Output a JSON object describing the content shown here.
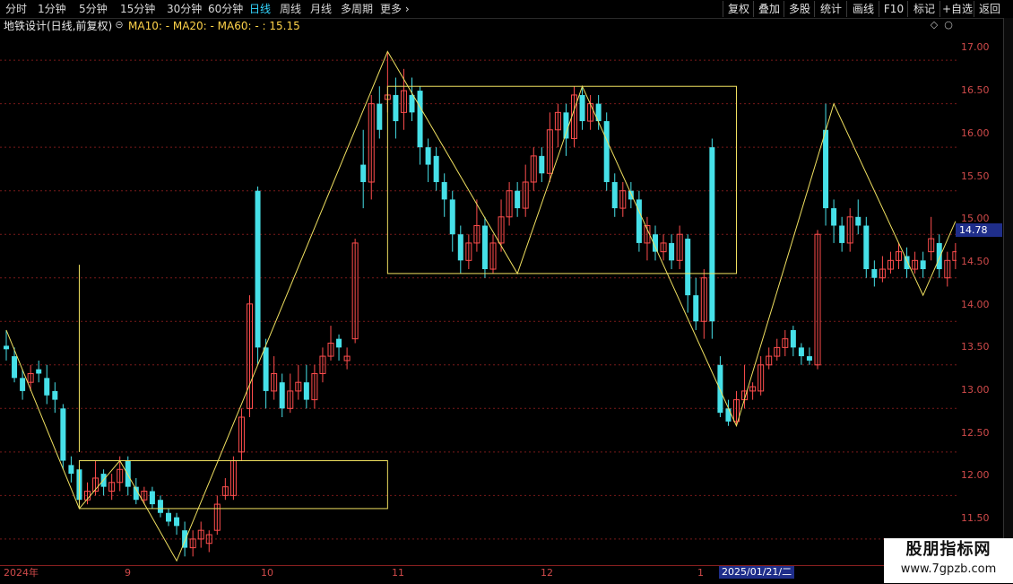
{
  "toolbar": {
    "periods": [
      "分时",
      "1分钟",
      "5分钟",
      "15分钟",
      "30分钟",
      "60分钟",
      "日线",
      "周线",
      "月线",
      "多周期",
      "更多"
    ],
    "active_period": "日线",
    "more_arrow": "chevron-right-icon",
    "right_buttons": [
      "复权",
      "叠加",
      "多股",
      "统计",
      "画线",
      "F10",
      "标记",
      "+自选",
      "返回"
    ]
  },
  "info": {
    "title": "地铁设计(日线,前复权)",
    "ma_text": "MA10: -  MA20: -  MA60: - : 15.15"
  },
  "price_axis": {
    "ticks": [
      "17.00",
      "16.50",
      "16.00",
      "15.50",
      "15.00",
      "14.50",
      "14.00",
      "13.50",
      "13.00",
      "12.50",
      "12.00",
      "11.50"
    ],
    "last_price": "14.78"
  },
  "date_axis": {
    "ticks": [
      "2024年",
      "9",
      "10",
      "11",
      "12",
      "1"
    ],
    "cursor_date": "2025/01/21/二"
  },
  "watermark": {
    "title": "股朋指标网",
    "url": "www.7gpzb.com"
  },
  "colors": {
    "up": "#ff4d4d",
    "down": "#46e0e8",
    "line": "#f0e060",
    "grid": "#7a1a1a",
    "axis": "#d04a4a"
  },
  "chart_data": {
    "type": "candlestick",
    "ylim": [
      11.2,
      17.3
    ],
    "candles": [
      [
        13.72,
        13.68,
        13.9,
        13.55
      ],
      [
        13.6,
        13.35,
        13.7,
        13.3
      ],
      [
        13.35,
        13.2,
        13.45,
        13.1
      ],
      [
        13.3,
        13.4,
        13.5,
        13.2
      ],
      [
        13.45,
        13.4,
        13.55,
        13.3
      ],
      [
        13.35,
        13.15,
        13.5,
        13.05
      ],
      [
        13.2,
        13.1,
        13.3,
        12.95
      ],
      [
        13.0,
        12.4,
        13.05,
        12.3
      ],
      [
        12.35,
        12.25,
        12.45,
        12.15
      ],
      [
        12.3,
        11.95,
        12.35,
        11.9
      ],
      [
        11.95,
        12.05,
        12.15,
        11.9
      ],
      [
        12.05,
        12.2,
        12.4,
        12.0
      ],
      [
        12.25,
        12.1,
        12.3,
        12.0
      ],
      [
        12.05,
        12.15,
        12.25,
        11.95
      ],
      [
        12.15,
        12.3,
        12.45,
        12.05
      ],
      [
        12.4,
        12.1,
        12.45,
        12.0
      ],
      [
        12.1,
        11.95,
        12.2,
        11.9
      ],
      [
        11.95,
        12.05,
        12.1,
        11.9
      ],
      [
        12.05,
        11.9,
        12.1,
        11.85
      ],
      [
        11.95,
        11.8,
        12.0,
        11.75
      ],
      [
        11.8,
        11.7,
        11.85,
        11.65
      ],
      [
        11.75,
        11.65,
        11.8,
        11.55
      ],
      [
        11.6,
        11.4,
        11.7,
        11.3
      ],
      [
        11.4,
        11.5,
        11.6,
        11.3
      ],
      [
        11.5,
        11.6,
        11.7,
        11.4
      ],
      [
        11.45,
        11.55,
        11.6,
        11.35
      ],
      [
        11.6,
        11.9,
        12.0,
        11.55
      ],
      [
        12.0,
        12.1,
        12.2,
        11.95
      ],
      [
        12.0,
        12.4,
        12.45,
        11.95
      ],
      [
        12.5,
        12.9,
        13.0,
        12.4
      ],
      [
        13.0,
        14.2,
        14.3,
        12.9
      ],
      [
        15.5,
        13.7,
        15.55,
        13.5
      ],
      [
        13.7,
        13.2,
        13.8,
        13.0
      ],
      [
        13.2,
        13.4,
        13.6,
        13.1
      ],
      [
        13.3,
        13.0,
        13.4,
        12.9
      ],
      [
        13.0,
        13.2,
        13.4,
        12.95
      ],
      [
        13.2,
        13.3,
        13.5,
        13.1
      ],
      [
        13.3,
        13.1,
        13.5,
        13.0
      ],
      [
        13.1,
        13.4,
        13.5,
        13.0
      ],
      [
        13.4,
        13.6,
        13.7,
        13.3
      ],
      [
        13.6,
        13.75,
        13.95,
        13.55
      ],
      [
        13.8,
        13.7,
        13.85,
        13.55
      ],
      [
        13.55,
        13.6,
        13.7,
        13.45
      ],
      [
        13.8,
        14.9,
        14.95,
        13.75
      ],
      [
        15.8,
        15.6,
        16.2,
        15.3
      ],
      [
        15.6,
        16.5,
        16.6,
        15.4
      ],
      [
        16.5,
        16.2,
        16.7,
        16.1
      ],
      [
        16.55,
        16.6,
        17.1,
        16.4
      ],
      [
        16.6,
        16.3,
        16.8,
        16.1
      ],
      [
        16.4,
        16.65,
        16.9,
        16.2
      ],
      [
        16.6,
        16.4,
        16.8,
        16.3
      ],
      [
        16.65,
        16.0,
        16.7,
        15.8
      ],
      [
        16.0,
        15.8,
        16.1,
        15.6
      ],
      [
        15.9,
        15.6,
        16.0,
        15.5
      ],
      [
        15.6,
        15.4,
        15.7,
        15.2
      ],
      [
        15.4,
        15.0,
        15.5,
        14.8
      ],
      [
        15.0,
        14.7,
        15.1,
        14.55
      ],
      [
        14.7,
        14.9,
        15.0,
        14.6
      ],
      [
        14.9,
        15.1,
        15.4,
        14.8
      ],
      [
        15.1,
        14.6,
        15.2,
        14.5
      ],
      [
        14.6,
        14.9,
        15.0,
        14.55
      ],
      [
        14.9,
        15.2,
        15.4,
        14.8
      ],
      [
        15.2,
        15.5,
        15.6,
        15.1
      ],
      [
        15.5,
        15.3,
        15.6,
        15.2
      ],
      [
        15.3,
        15.6,
        15.8,
        15.2
      ],
      [
        15.6,
        15.9,
        16.0,
        15.5
      ],
      [
        15.9,
        15.7,
        16.0,
        15.6
      ],
      [
        15.7,
        16.2,
        16.4,
        15.6
      ],
      [
        16.2,
        16.4,
        16.5,
        16.0
      ],
      [
        16.4,
        16.1,
        16.5,
        15.9
      ],
      [
        16.1,
        16.6,
        16.7,
        16.0
      ],
      [
        16.6,
        16.3,
        16.7,
        16.2
      ],
      [
        16.3,
        16.5,
        16.6,
        16.2
      ],
      [
        16.5,
        16.3,
        16.6,
        16.2
      ],
      [
        16.3,
        15.6,
        16.4,
        15.5
      ],
      [
        15.6,
        15.3,
        15.7,
        15.2
      ],
      [
        15.3,
        15.5,
        15.6,
        15.2
      ],
      [
        15.5,
        15.4,
        15.6,
        15.3
      ],
      [
        15.4,
        14.9,
        15.5,
        14.8
      ],
      [
        14.9,
        15.1,
        15.2,
        14.7
      ],
      [
        15.0,
        14.8,
        15.1,
        14.7
      ],
      [
        14.8,
        14.9,
        15.0,
        14.7
      ],
      [
        14.9,
        14.7,
        15.0,
        14.6
      ],
      [
        14.7,
        15.0,
        15.1,
        14.6
      ],
      [
        14.95,
        14.3,
        15.0,
        14.1
      ],
      [
        14.3,
        14.0,
        14.5,
        13.9
      ],
      [
        14.0,
        14.5,
        14.6,
        13.8
      ],
      [
        16.0,
        14.0,
        16.1,
        13.8
      ],
      [
        13.5,
        12.95,
        13.6,
        12.9
      ],
      [
        13.0,
        12.85,
        13.1,
        12.8
      ],
      [
        12.85,
        13.1,
        13.2,
        12.8
      ],
      [
        13.1,
        13.2,
        13.5,
        13.0
      ],
      [
        13.2,
        13.25,
        13.3,
        13.1
      ],
      [
        13.2,
        13.5,
        13.6,
        13.15
      ],
      [
        13.5,
        13.6,
        13.7,
        13.45
      ],
      [
        13.6,
        13.7,
        13.8,
        13.55
      ],
      [
        13.7,
        13.8,
        13.9,
        13.6
      ],
      [
        13.9,
        13.7,
        13.95,
        13.6
      ],
      [
        13.7,
        13.6,
        13.75,
        13.5
      ],
      [
        13.6,
        13.55,
        13.7,
        13.5
      ],
      [
        13.5,
        15.0,
        15.05,
        13.45
      ],
      [
        16.2,
        15.3,
        16.5,
        15.1
      ],
      [
        15.3,
        15.1,
        15.4,
        14.9
      ],
      [
        15.1,
        14.9,
        15.2,
        14.8
      ],
      [
        14.9,
        15.2,
        15.3,
        14.8
      ],
      [
        15.2,
        15.1,
        15.4,
        15.0
      ],
      [
        15.1,
        14.6,
        15.2,
        14.5
      ],
      [
        14.6,
        14.5,
        14.7,
        14.4
      ],
      [
        14.5,
        14.6,
        14.75,
        14.45
      ],
      [
        14.6,
        14.7,
        14.8,
        14.55
      ],
      [
        14.7,
        14.8,
        14.9,
        14.6
      ],
      [
        14.75,
        14.6,
        14.85,
        14.5
      ],
      [
        14.6,
        14.7,
        14.8,
        14.55
      ],
      [
        14.7,
        14.6,
        14.8,
        14.5
      ],
      [
        14.8,
        14.95,
        15.2,
        14.7
      ],
      [
        14.9,
        14.6,
        15.0,
        14.5
      ],
      [
        14.5,
        14.7,
        14.8,
        14.4
      ],
      [
        14.7,
        14.8,
        14.9,
        14.6
      ]
    ],
    "zigzag": [
      [
        0,
        13.9
      ],
      [
        9,
        11.85
      ],
      [
        14,
        12.4
      ],
      [
        21,
        11.25
      ],
      [
        47,
        17.1
      ],
      [
        63,
        14.55
      ],
      [
        71,
        16.7
      ],
      [
        90,
        12.8
      ],
      [
        102,
        16.5
      ],
      [
        113,
        14.3
      ],
      [
        117,
        15.15
      ]
    ],
    "rects": [
      {
        "i0": 47,
        "i1": 90,
        "top": 16.7,
        "bottom": 14.55
      },
      {
        "i0": 9,
        "i1": 47,
        "top": 12.4,
        "bottom": 11.85
      }
    ],
    "vline": {
      "i": 9,
      "top": 14.65,
      "bottom": 12.5
    }
  }
}
